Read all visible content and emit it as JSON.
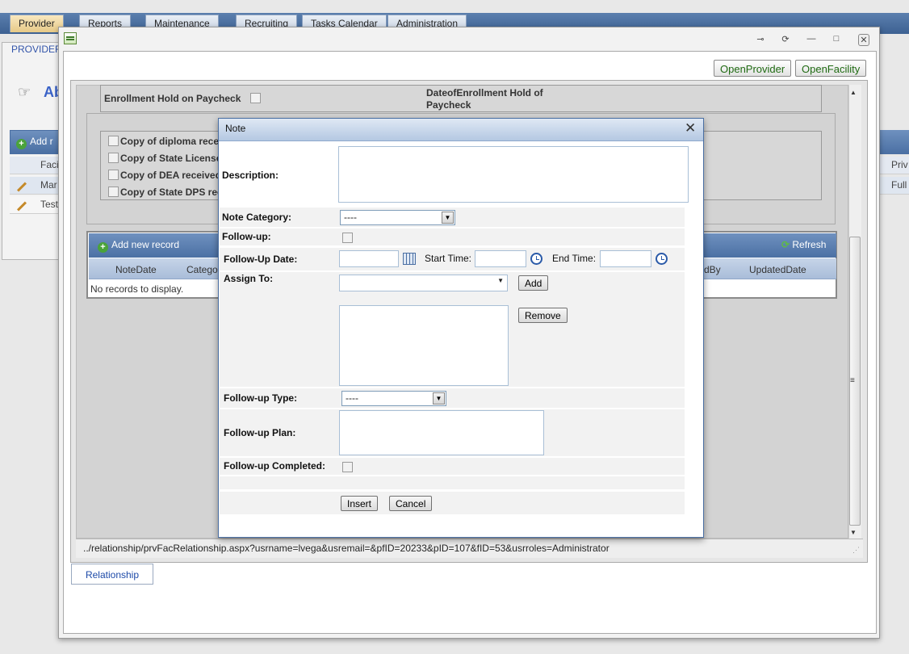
{
  "top_tabs": [
    "Provider",
    "Reports",
    "Maintenance",
    "Recruiting",
    "Tasks Calendar",
    "Administration"
  ],
  "background": {
    "provider_label": "PROVIDER",
    "heading_partial": "Ab",
    "add_partial": "Add r",
    "col_partial": "Faci",
    "rows": [
      "Mar",
      "Test"
    ],
    "right_col": "Priv",
    "right_row": "Full"
  },
  "window": {
    "controls": {
      "pin": "⊸",
      "refresh": "⟳",
      "minimize": "—",
      "maximize": "□",
      "close": "✕"
    },
    "buttons": {
      "open_provider": "OpenProvider",
      "open_facility": "OpenFacility"
    }
  },
  "relationship": {
    "enrollment_hold_label": "Enrollment Hold on Paycheck",
    "date_enrollment_hold_label": "DateofEnrollment Hold of Paycheck",
    "copies": [
      "Copy of diploma recei",
      "Copy of State License",
      "Copy of DEA received",
      "Copy of State DPS rec"
    ],
    "notes_grid": {
      "add_new": "Add new record",
      "refresh": "Refresh",
      "columns": [
        "NoteDate",
        "Catego",
        "dBy",
        "UpdatedDate"
      ],
      "empty": "No records to display."
    },
    "url": "../relationship/prvFacRelationship.aspx?usrname=lvega&usremail=&pfID=20233&pID=107&fID=53&usrroles=Administrator",
    "tab": "Relationship"
  },
  "note_dialog": {
    "title": "Note",
    "close": "✕",
    "description_label": "Description:",
    "description_value": "",
    "category_label": "Note Category:",
    "category_value": "----",
    "followup_label": "Follow-up:",
    "followup_date_label": "Follow-Up Date:",
    "start_time_label": "Start Time:",
    "end_time_label": "End Time:",
    "assign_to_label": "Assign To:",
    "add_button": "Add",
    "remove_button": "Remove",
    "followup_type_label": "Follow-up Type:",
    "followup_type_value": "----",
    "followup_plan_label": "Follow-up Plan:",
    "followup_completed_label": "Follow-up Completed:",
    "insert_button": "Insert",
    "cancel_button": "Cancel"
  }
}
